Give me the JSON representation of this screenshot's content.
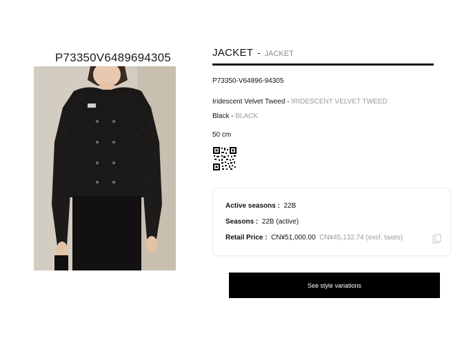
{
  "left_title": "P73350V6489694305",
  "product": {
    "title": "JACKET",
    "separator": "-",
    "subtitle": "JACKET",
    "reference": "P73350-V64896-94305",
    "material": "Iridescent Velvet Tweed",
    "material_sep": " - ",
    "material_alt": "IRIDESCENT VELVET TWEED",
    "color": "Black",
    "color_sep": " - ",
    "color_alt": "BLACK",
    "size": "50 cm"
  },
  "info": {
    "active_seasons_label": "Active seasons :",
    "active_seasons_value": "22B",
    "seasons_label": "Seasons :",
    "seasons_value": "22B (active)",
    "retail_price_label": "Retail Price :",
    "retail_price_value": "CN¥51,000.00",
    "retail_price_excl": "CN¥45,132.74 (excl. taxes)"
  },
  "button": {
    "label": "See style variations"
  },
  "icons": {
    "qr": "qr-code-icon",
    "copy": "copy-icon"
  }
}
